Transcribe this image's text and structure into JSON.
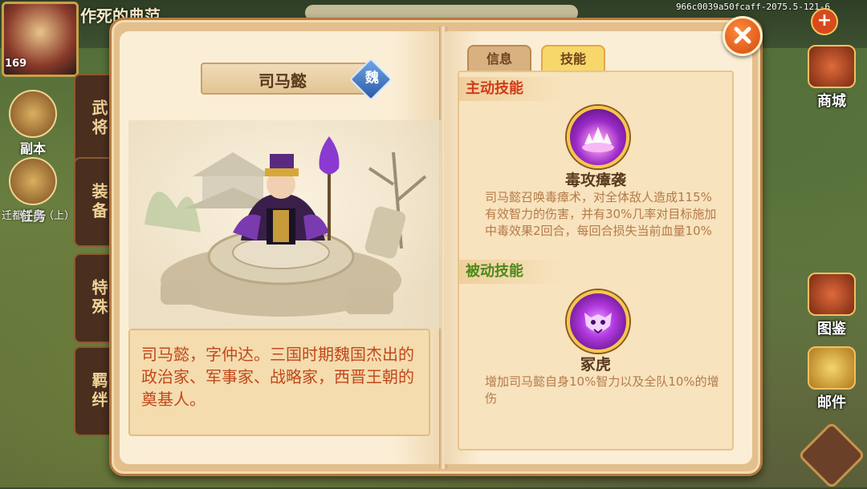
{
  "hud": {
    "level": "169",
    "player_title": "作死的典范",
    "build_id": "966c0039a50fcaff-2075.5-121-6",
    "left_buttons": [
      {
        "label": "副本",
        "icon": "sword-icon"
      },
      {
        "label": "任务",
        "icon": "scroll-icon"
      }
    ],
    "quest_text": "迁都许昌（上）",
    "side_tabs": [
      "武将",
      "装备",
      "特殊",
      "羁绊"
    ],
    "right_buttons": [
      {
        "label": "商城",
        "icon": "shop-icon"
      },
      {
        "label": "图鉴",
        "icon": "codex-icon"
      },
      {
        "label": "邮件",
        "icon": "mail-icon"
      }
    ]
  },
  "hero": {
    "name": "司马懿",
    "faction": "魏",
    "description": "司马懿，字仲达。三国时期魏国杰出的政治家、军事家、战略家，西晋王朝的奠基人。"
  },
  "tabs": {
    "info": "信息",
    "skill": "技能",
    "selected": "skill"
  },
  "skills": {
    "active_header": "主动技能",
    "passive_header": "被动技能",
    "active": {
      "icon": "poison-burst-icon",
      "name": "毒攻瘴袭",
      "desc": "司马懿召唤毒瘴术，对全体敌人造成115%有效智力的伤害，并有30%几率对目标施加中毒效果2回合，每回合损失当前血量10%"
    },
    "passive": {
      "icon": "tiger-head-icon",
      "name": "冢虎",
      "desc": "增加司马懿自身10%智力以及全队10%的增伤"
    }
  },
  "colors": {
    "active_header": "#d23a16",
    "passive_header": "#4a8a1a",
    "description_text": "#c1481b",
    "skill_desc_text": "#b57a4a",
    "close_button": "#e0581a"
  }
}
